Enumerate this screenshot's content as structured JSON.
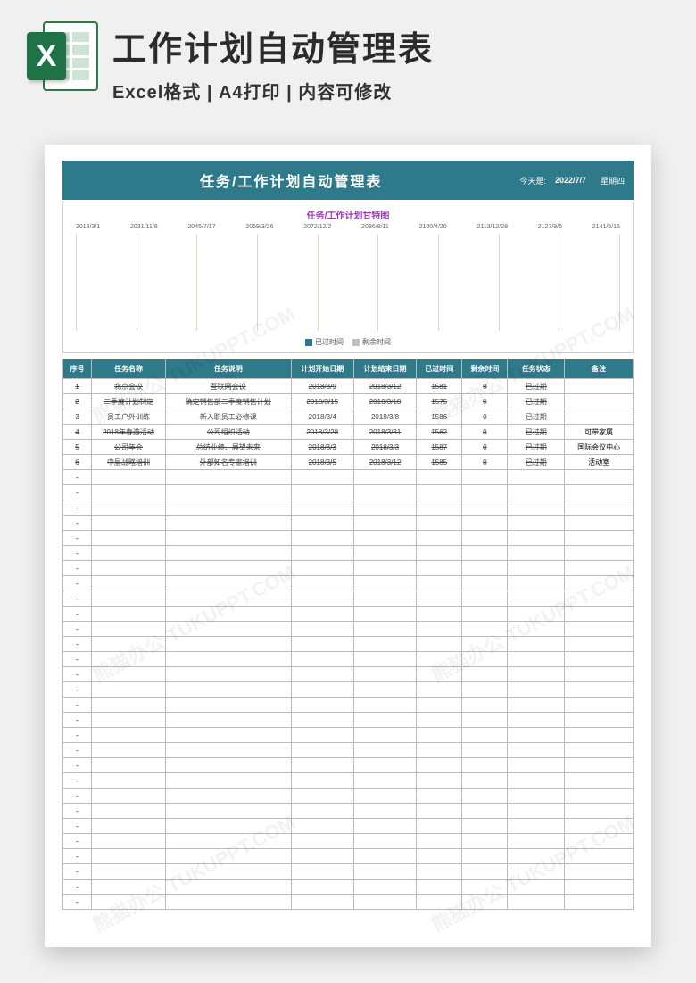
{
  "banner": {
    "main_title": "工作计划自动管理表",
    "sub_title": "Excel格式 | A4打印 | 内容可修改",
    "icon_glyph": "X"
  },
  "sheet": {
    "title": "任务/工作计划自动管理表",
    "today_label": "今天是:",
    "today_value": "2022/7/7",
    "weekday": "星期四"
  },
  "chart_data": {
    "type": "bar",
    "title": "任务/工作计划甘特图",
    "categories": [
      "2018/3/1",
      "2031/11/8",
      "2045/7/17",
      "2059/3/26",
      "2072/12/2",
      "2086/8/11",
      "2100/4/20",
      "2113/12/28",
      "2127/9/6",
      "2141/5/15"
    ],
    "series": [
      {
        "name": "已过时间",
        "values": [
          0,
          0,
          0,
          0,
          0,
          0,
          0,
          0,
          0,
          0
        ]
      },
      {
        "name": "剩余时间",
        "values": [
          0,
          0,
          0,
          0,
          0,
          0,
          0,
          0,
          0,
          0
        ]
      }
    ],
    "xlabel": "",
    "ylabel": "",
    "legend": [
      "已过时间",
      "剩余时间"
    ]
  },
  "columns": [
    "序号",
    "任务名称",
    "任务说明",
    "计划开始日期",
    "计划结束日期",
    "已过时间",
    "剩余时间",
    "任务状态",
    "备注"
  ],
  "rows": [
    {
      "idx": "1",
      "name": "北京会议",
      "desc": "互联网会议",
      "start": "2018/3/9",
      "end": "2018/3/12",
      "elapsed": "1581",
      "remain": "0",
      "status": "已过期",
      "note": "",
      "strike": true
    },
    {
      "idx": "2",
      "name": "二季度计划制定",
      "desc": "确定销售部二季度销售计划",
      "start": "2018/3/15",
      "end": "2018/3/18",
      "elapsed": "1575",
      "remain": "0",
      "status": "已过期",
      "note": "",
      "strike": true
    },
    {
      "idx": "3",
      "name": "员工户外训练",
      "desc": "新入职员工必修课",
      "start": "2018/3/4",
      "end": "2018/3/8",
      "elapsed": "1586",
      "remain": "0",
      "status": "已过期",
      "note": "",
      "strike": true
    },
    {
      "idx": "4",
      "name": "2018年春游活动",
      "desc": "公司组织活动",
      "start": "2018/3/28",
      "end": "2018/3/31",
      "elapsed": "1562",
      "remain": "0",
      "status": "已过期",
      "note": "可带家属",
      "strike": true
    },
    {
      "idx": "5",
      "name": "公司年会",
      "desc": "总结业绩、展望未来",
      "start": "2018/3/3",
      "end": "2018/3/3",
      "elapsed": "1587",
      "remain": "0",
      "status": "已过期",
      "note": "国际会议中心",
      "strike": true
    },
    {
      "idx": "6",
      "name": "中层战略培训",
      "desc": "外部知名专家培训",
      "start": "2018/3/5",
      "end": "2018/3/12",
      "elapsed": "1585",
      "remain": "0",
      "status": "已过期",
      "note": "活动室",
      "strike": true
    }
  ],
  "empty_placeholder": "-",
  "empty_row_count": 29,
  "watermark_text": "熊猫办公 TUKUPPT.COM"
}
